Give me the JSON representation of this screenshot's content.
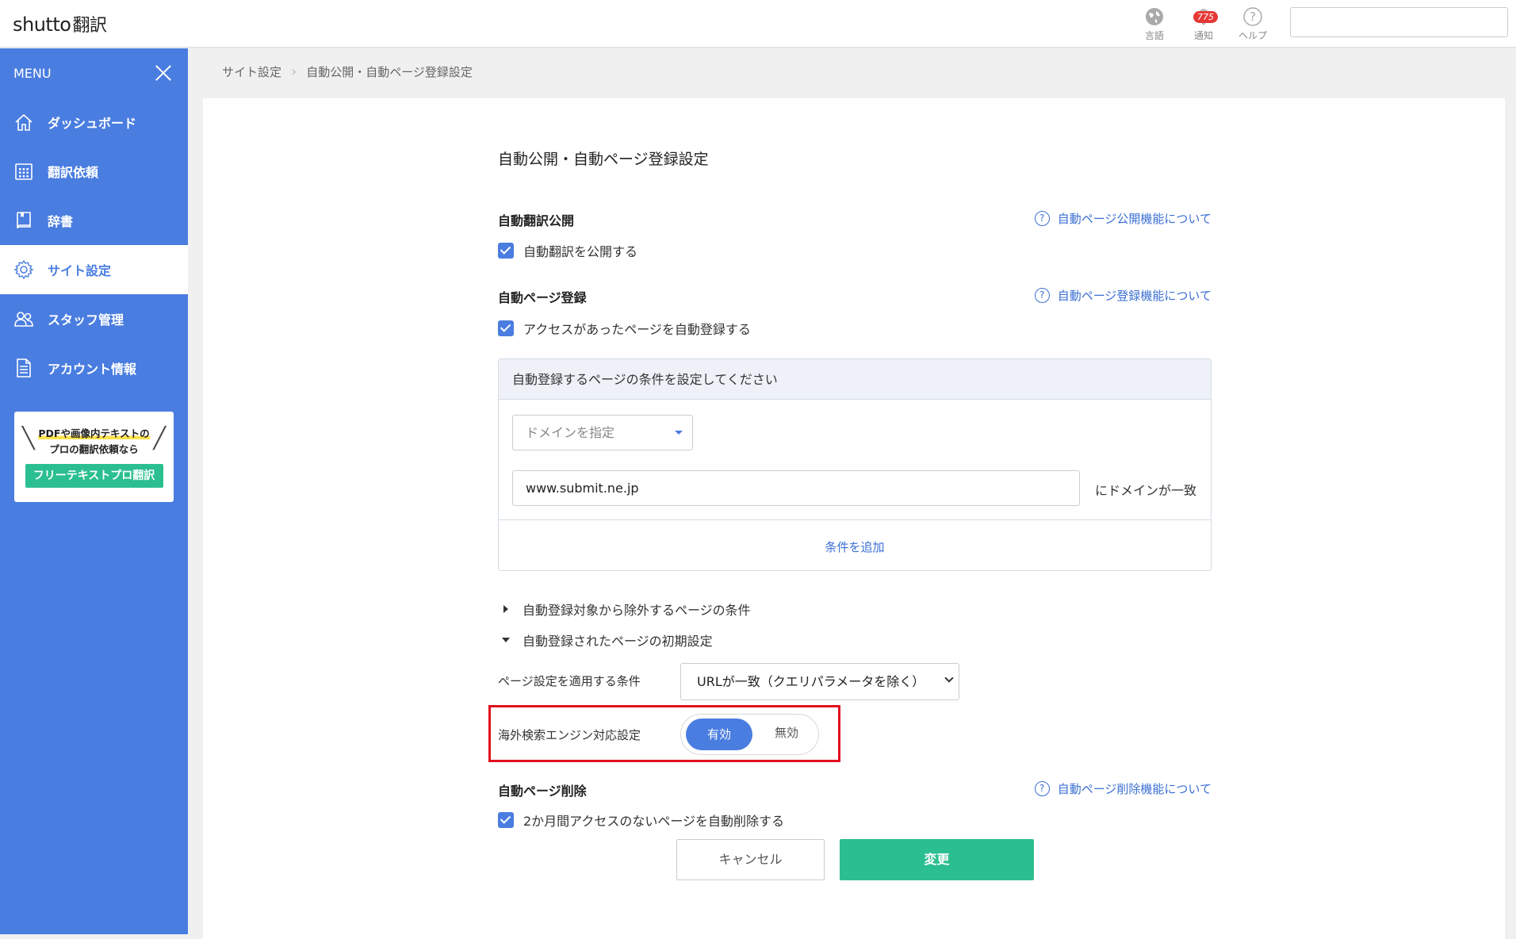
{
  "header": {
    "logo_text": "shutto",
    "logo_jp": "翻訳",
    "language_label": "言語",
    "notification_label": "通知",
    "notification_count": "775",
    "help_label": "ヘルプ",
    "search_value": ""
  },
  "sidebar": {
    "menu_label": "MENU",
    "items": [
      {
        "label": "ダッシュボード",
        "icon": "home-icon"
      },
      {
        "label": "翻訳依頼",
        "icon": "calendar-grid-icon"
      },
      {
        "label": "辞書",
        "icon": "book-icon"
      },
      {
        "label": "サイト設定",
        "icon": "gear-icon"
      },
      {
        "label": "スタッフ管理",
        "icon": "users-icon"
      },
      {
        "label": "アカウント情報",
        "icon": "document-icon"
      }
    ],
    "promo": {
      "line1": "PDFや画像内テキストの",
      "line2": "プロの翻訳依頼なら",
      "button": "フリーテキストプロ翻訳"
    }
  },
  "breadcrumb": {
    "items": [
      "サイト設定",
      "自動公開・自動ページ登録設定"
    ]
  },
  "main": {
    "title": "自動公開・自動ページ登録設定",
    "auto_publish": {
      "title": "自動翻訳公開",
      "help_link": "自動ページ公開機能について",
      "checkbox_label": "自動翻訳を公開する",
      "checked": true
    },
    "auto_register": {
      "title": "自動ページ登録",
      "help_link": "自動ページ登録機能について",
      "checkbox_label": "アクセスがあったページを自動登録する",
      "checked": true
    },
    "conditions": {
      "header": "自動登録するページの条件を設定してください",
      "select_placeholder": "ドメインを指定",
      "domain_value": "www.submit.ne.jp",
      "domain_suffix": "にドメインが一致",
      "add_condition": "条件を追加"
    },
    "exclude_toggle": "自動登録対象から除外するページの条件",
    "initial_toggle": "自動登録されたページの初期設定",
    "page_condition_label": "ページ設定を適用する条件",
    "page_condition_value": "URLが一致（クエリパラメータを除く）",
    "seo_label": "海外検索エンジン対応設定",
    "seo_on": "有効",
    "seo_off": "無効",
    "seo_enabled": true,
    "auto_delete": {
      "title": "自動ページ削除",
      "help_link": "自動ページ削除機能について",
      "checkbox_label": "2か月間アクセスのないページを自動削除する",
      "checked": true
    },
    "cancel_button": "キャンセル",
    "submit_button": "変更"
  },
  "colors": {
    "primary": "#4a7de0",
    "accent_green": "#2bbf8f",
    "highlight_red": "#e0101e",
    "link_blue": "#3b6fd4"
  }
}
